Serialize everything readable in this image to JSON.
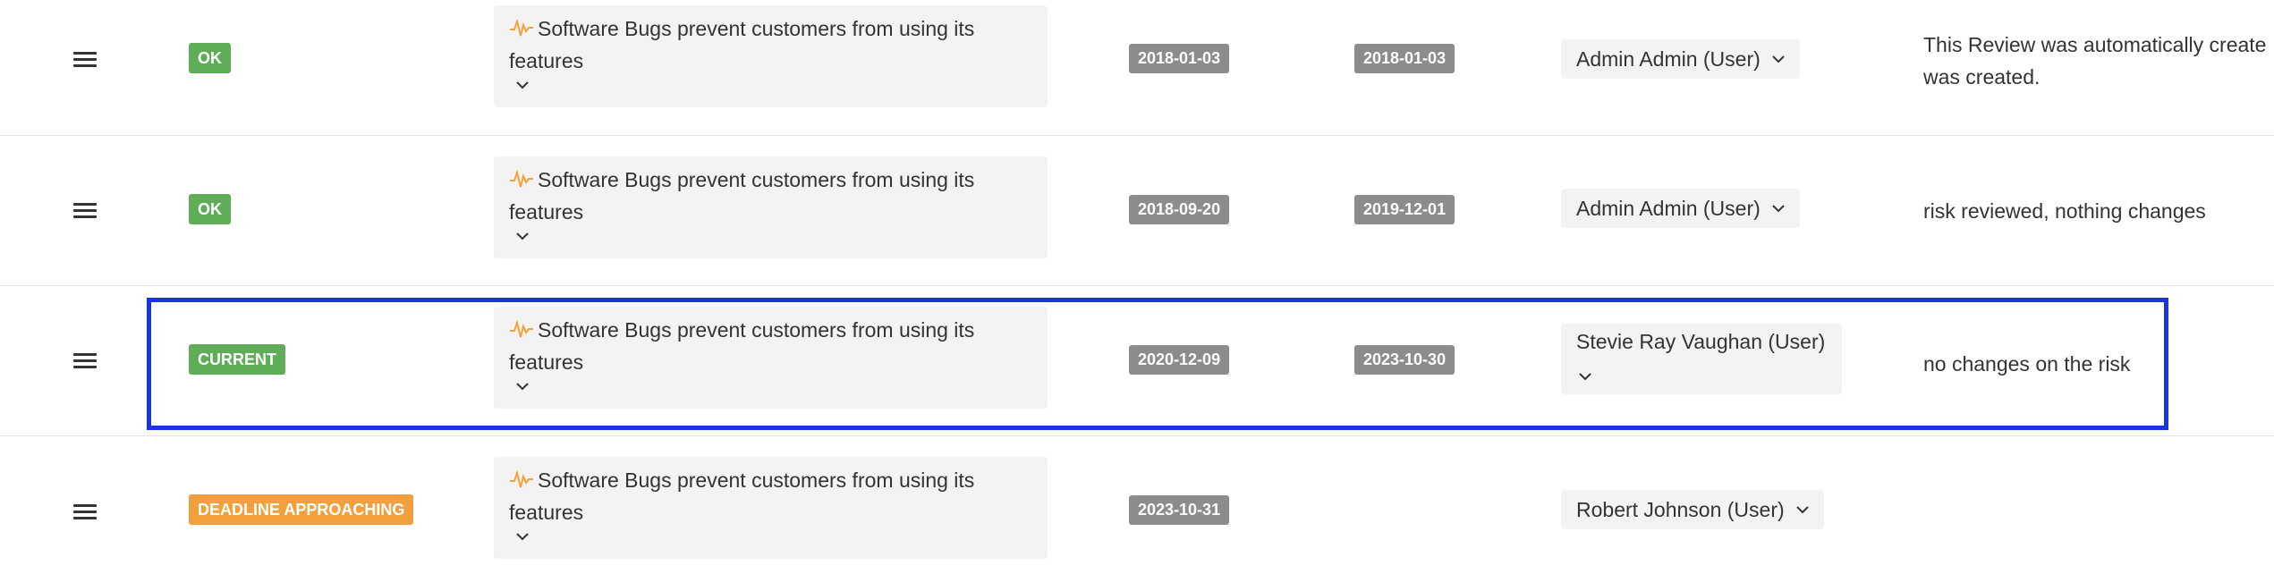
{
  "colors": {
    "ok_green": "#5fae57",
    "deadline_orange": "#f2a03d",
    "date_gray": "#8c8c8c",
    "risk_icon_orange": "#f2a03d",
    "highlight_blue": "#1a35e0"
  },
  "rows": [
    {
      "status": "OK",
      "risk_title": "Software Bugs prevent customers from using its features",
      "date1": "2018-01-03",
      "date2": "2018-01-03",
      "user": "Admin Admin (User)",
      "comment_line1": "This Review was automatically create",
      "comment_line2": "was created."
    },
    {
      "status": "OK",
      "risk_title": "Software Bugs prevent customers from using its features",
      "date1": "2018-09-20",
      "date2": "2019-12-01",
      "user": "Admin Admin (User)",
      "comment_line1": "risk reviewed, nothing changes"
    },
    {
      "status": "CURRENT",
      "risk_title": "Software Bugs prevent customers from using its features",
      "date1": "2020-12-09",
      "date2": "2023-10-30",
      "user": "Stevie Ray Vaughan (User)",
      "comment_line1": "no changes on the risk"
    },
    {
      "status": "DEADLINE APPROACHING",
      "risk_title": "Software Bugs prevent customers from using its features",
      "date1": "2023-10-31",
      "user": "Robert Johnson (User)"
    }
  ]
}
